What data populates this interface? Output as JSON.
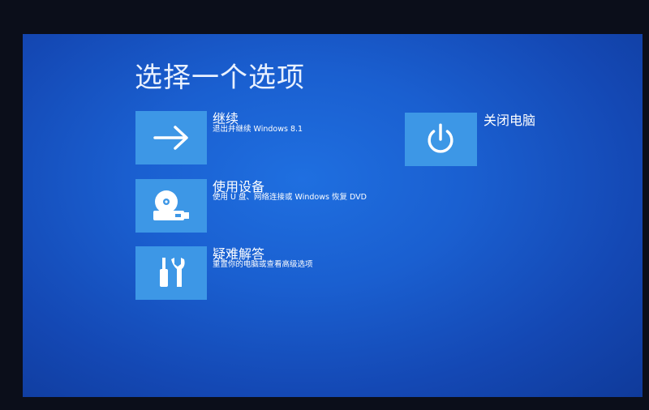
{
  "title": "选择一个选项",
  "options": [
    {
      "label": "继续",
      "description": "退出并继续 Windows 8.1",
      "icon": "arrow-right-icon"
    },
    {
      "label": "使用设备",
      "description": "使用 U 盘、网络连接或 Windows 恢复 DVD",
      "icon": "drive-disc-icon"
    },
    {
      "label": "疑难解答",
      "description": "重置你的电脑或查看高级选项",
      "icon": "tools-icon"
    },
    {
      "label": "关闭电脑",
      "description": "",
      "icon": "power-icon"
    }
  ],
  "colors": {
    "background": "#1a5fd0",
    "tile": "#3d97e6",
    "text": "#ffffff"
  }
}
